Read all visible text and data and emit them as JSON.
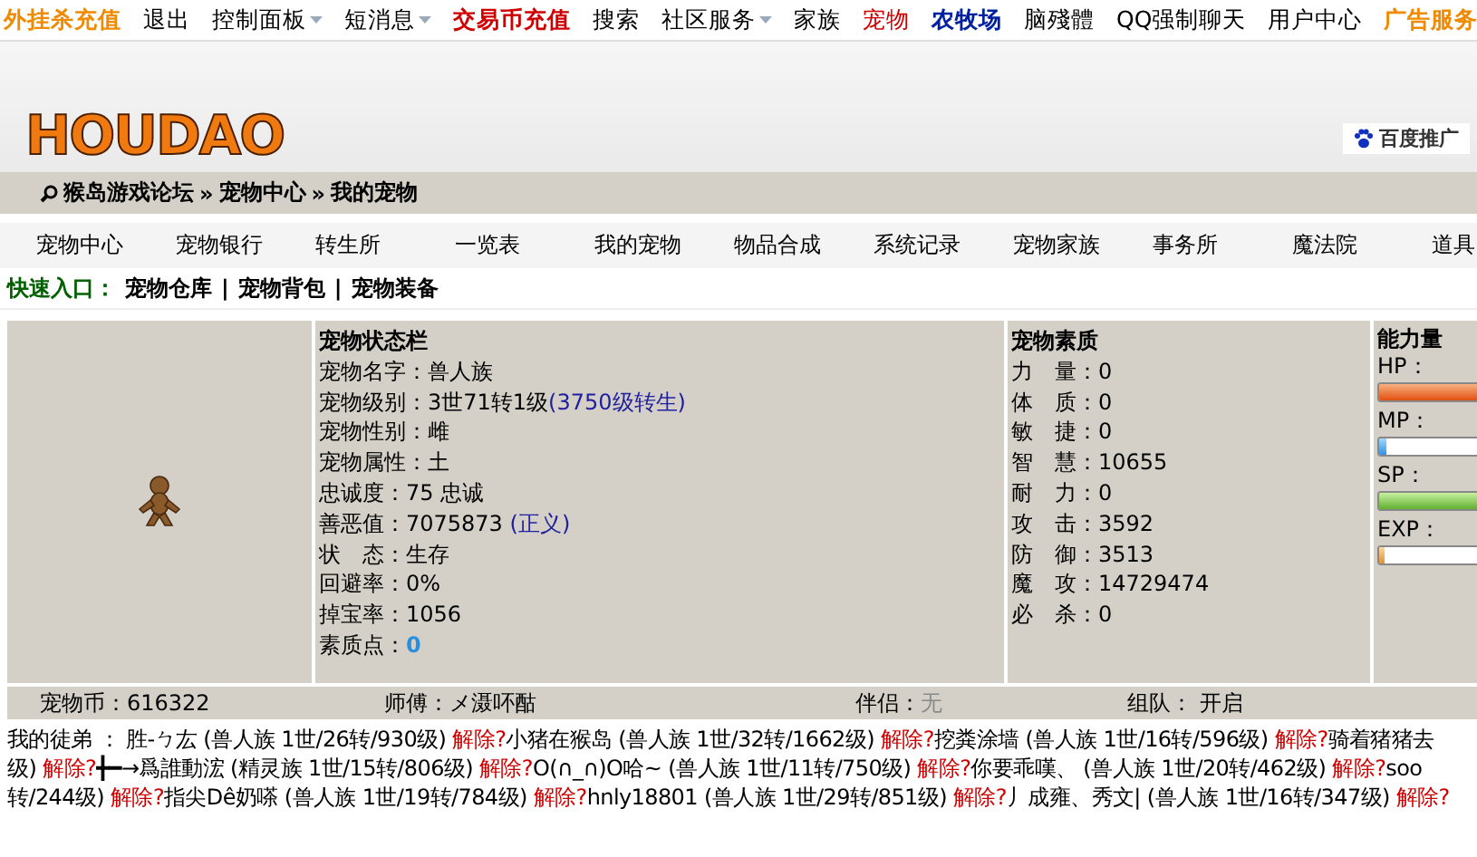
{
  "top_menu": [
    {
      "label": "外挂杀充值",
      "kind": "promo"
    },
    {
      "label": "退出",
      "kind": "plain"
    },
    {
      "label": "控制面板",
      "kind": "dropdown"
    },
    {
      "label": "短消息",
      "kind": "dropdown"
    },
    {
      "label": "交易币充值",
      "kind": "hot"
    },
    {
      "label": "搜索",
      "kind": "plain"
    },
    {
      "label": "社区服务",
      "kind": "dropdown"
    },
    {
      "label": "家族",
      "kind": "plain"
    },
    {
      "label": "宠物",
      "kind": "pet"
    },
    {
      "label": "农牧场",
      "kind": "farm"
    },
    {
      "label": "脑殘體",
      "kind": "plain"
    },
    {
      "label": "QQ强制聊天",
      "kind": "plain"
    },
    {
      "label": "用户中心",
      "kind": "plain"
    },
    {
      "label": "广告服务",
      "kind": "promo"
    }
  ],
  "header": {
    "logo": "HOUDAO",
    "ad_badge": "百度推广"
  },
  "breadcrumb": {
    "separator": "»",
    "items": [
      "猴岛游戏论坛",
      "宠物中心",
      "我的宠物"
    ]
  },
  "tabs": [
    "宠物中心",
    "宠物银行",
    "转生所",
    "一览表",
    "我的宠物",
    "物品合成",
    "系统记录",
    "宠物家族",
    "事务所",
    "魔法院",
    "道具"
  ],
  "quick_entry": {
    "label": "快速入口：",
    "separator": "|",
    "links": [
      "宠物仓库",
      "宠物背包",
      "宠物装备"
    ]
  },
  "status": {
    "title": "宠物状态栏",
    "rows": [
      {
        "label": "宠物名字：",
        "value": "兽人族",
        "kind": "plain"
      },
      {
        "label": "宠物级别：",
        "value": "3世71转1级",
        "link": "(3750级转生)",
        "kind": "link"
      },
      {
        "label": "宠物性别：",
        "value": "雌",
        "kind": "plain"
      },
      {
        "label": "宠物属性：",
        "value": "土",
        "kind": "plain"
      },
      {
        "label": "忠诚度：",
        "value": "75 忠诚",
        "kind": "plain"
      },
      {
        "label": "善恶值：",
        "value": "7075873 ",
        "link": "(正义)",
        "kind": "link"
      },
      {
        "label": "状　态：",
        "value": "生存",
        "kind": "plain"
      },
      {
        "label": "回避率：",
        "value": "0%",
        "kind": "plain"
      },
      {
        "label": "掉宝率：",
        "value": "1056",
        "kind": "plain"
      },
      {
        "label": "素质点：",
        "value": "0",
        "kind": "accent"
      }
    ]
  },
  "quality": {
    "title": "宠物素质",
    "rows": [
      {
        "label": "力　量：",
        "value": "0"
      },
      {
        "label": "体　质：",
        "value": "0"
      },
      {
        "label": "敏　捷：",
        "value": "0"
      },
      {
        "label": "智　慧：",
        "value": "10655"
      },
      {
        "label": "耐　力：",
        "value": "0"
      },
      {
        "label": "攻　击：",
        "value": "3592"
      },
      {
        "label": "防　御：",
        "value": "3513"
      },
      {
        "label": "魔　攻：",
        "value": "14729474"
      },
      {
        "label": "必　杀：",
        "value": "0"
      }
    ]
  },
  "ability": {
    "title": "能力量",
    "meters": [
      {
        "label": "HP：",
        "kind": "hp",
        "level": 1
      },
      {
        "label": "MP：",
        "kind": "mp",
        "level": 0.06
      },
      {
        "label": "SP：",
        "kind": "sp",
        "level": 1
      },
      {
        "label": "EXP：",
        "kind": "exp",
        "level": 0.05
      }
    ]
  },
  "footer": [
    {
      "label": "宠物币：",
      "value": "616322",
      "kind": "plain"
    },
    {
      "label": "师傅：",
      "value": "メ滠吥酤",
      "kind": "plain"
    },
    {
      "label": "伴侣：",
      "value": "无",
      "kind": "muted"
    },
    {
      "label": "组队：",
      "value": " 开启",
      "kind": "plain"
    }
  ],
  "disciples": {
    "lines": [
      [
        {
          "text": "我的徒弟 ：  胜-ㄅ厷 (兽人族 1世/26转/930级) ",
          "kind": "text"
        },
        {
          "text": "解除?",
          "kind": "action"
        },
        {
          "text": "小猪在猴岛 (兽人族 1世/32转/1662级) ",
          "kind": "text"
        },
        {
          "text": "解除?",
          "kind": "action"
        },
        {
          "text": "挖粪涂墙 (兽人族 1世/16转/596级) ",
          "kind": "text"
        },
        {
          "text": "解除?",
          "kind": "action"
        },
        {
          "text": "骑着猪猪去",
          "kind": "text"
        }
      ],
      [
        {
          "text": "级) ",
          "kind": "text"
        },
        {
          "text": "解除?",
          "kind": "action"
        },
        {
          "text": "╋━→爲誰動浤 (精灵族 1世/15转/806级) ",
          "kind": "text"
        },
        {
          "text": "解除?",
          "kind": "action"
        },
        {
          "text": "O(∩_∩)O哈~ (兽人族 1世/11转/750级) ",
          "kind": "text"
        },
        {
          "text": "解除?",
          "kind": "action"
        },
        {
          "text": "你要乖嘆、 (兽人族 1世/20转/462级) ",
          "kind": "text"
        },
        {
          "text": "解除?",
          "kind": "action"
        },
        {
          "text": "soo",
          "kind": "text"
        }
      ],
      [
        {
          "text": "转/244级) ",
          "kind": "text"
        },
        {
          "text": "解除?",
          "kind": "action"
        },
        {
          "text": "指尖Dê奶嗏 (兽人族 1世/19转/784级) ",
          "kind": "text"
        },
        {
          "text": "解除?",
          "kind": "action"
        },
        {
          "text": "hnly18801 (兽人族 1世/29转/851级) ",
          "kind": "text"
        },
        {
          "text": "解除?",
          "kind": "action"
        },
        {
          "text": "丿成雍、秀文| (兽人族 1世/16转/347级) ",
          "kind": "text"
        },
        {
          "text": "解除?",
          "kind": "action"
        }
      ]
    ]
  }
}
